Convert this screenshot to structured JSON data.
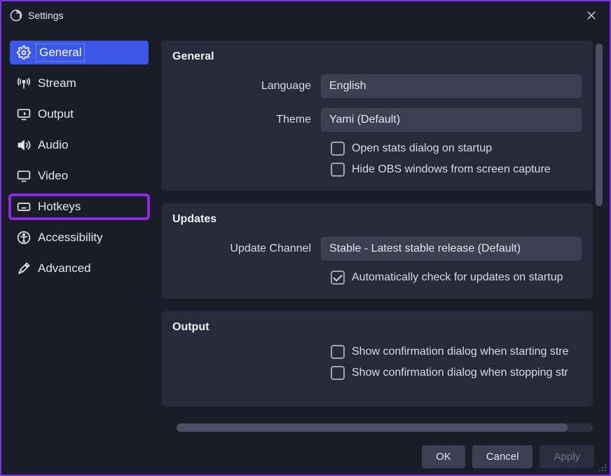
{
  "window": {
    "title": "Settings"
  },
  "sidebar": {
    "items": [
      {
        "id": "general",
        "label": "General",
        "selected": true
      },
      {
        "id": "stream",
        "label": "Stream"
      },
      {
        "id": "output",
        "label": "Output"
      },
      {
        "id": "audio",
        "label": "Audio"
      },
      {
        "id": "video",
        "label": "Video"
      },
      {
        "id": "hotkeys",
        "label": "Hotkeys",
        "highlighted": true
      },
      {
        "id": "accessibility",
        "label": "Accessibility"
      },
      {
        "id": "advanced",
        "label": "Advanced"
      }
    ]
  },
  "sections": {
    "general": {
      "title": "General",
      "language_label": "Language",
      "language_value": "English",
      "theme_label": "Theme",
      "theme_value": "Yami (Default)",
      "open_stats_label": "Open stats dialog on startup",
      "open_stats_checked": false,
      "hide_obs_label": "Hide OBS windows from screen capture",
      "hide_obs_checked": false
    },
    "updates": {
      "title": "Updates",
      "channel_label": "Update Channel",
      "channel_value": "Stable - Latest stable release (Default)",
      "auto_check_label": "Automatically check for updates on startup",
      "auto_check_checked": true
    },
    "output": {
      "title": "Output",
      "confirm_start_label": "Show confirmation dialog when starting stre",
      "confirm_start_checked": false,
      "confirm_stop_label": "Show confirmation dialog when stopping str",
      "confirm_stop_checked": false
    }
  },
  "footer": {
    "ok": "OK",
    "cancel": "Cancel",
    "apply": "Apply"
  }
}
